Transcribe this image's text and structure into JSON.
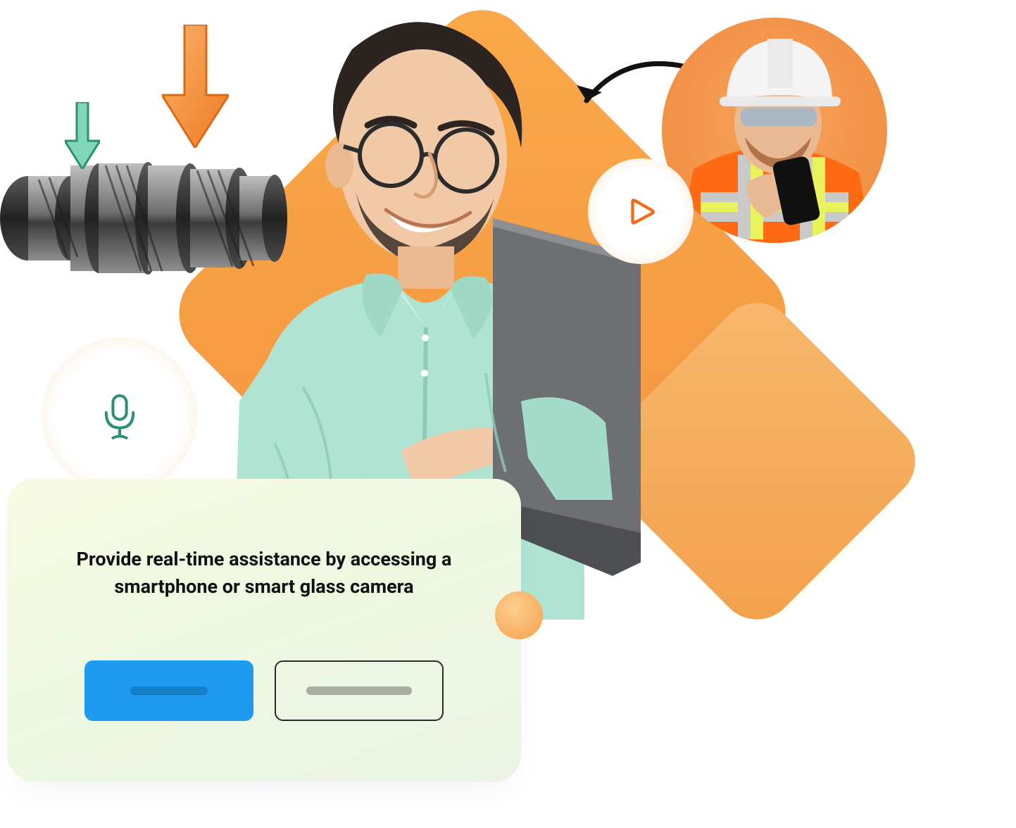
{
  "colors": {
    "accent_orange": "#f3923e",
    "accent_blue": "#1e9bf0",
    "shirt_mint": "#afe3d2",
    "hivis_orange": "#ff6a13",
    "icon_teal": "#2f8f74",
    "icon_orange": "#f26b1d"
  },
  "icons": {
    "play": "play-icon",
    "mic": "microphone-icon",
    "swap": "swap-arrow-icon",
    "down_arrow_big": "down-arrow-icon",
    "down_arrow_small": "down-arrow-icon"
  },
  "people": {
    "expert": "person-with-laptop",
    "technician": "field-technician-with-phone"
  },
  "equipment": {
    "name": "transmission-gear-assembly"
  },
  "card": {
    "headline_line1": "Provide real-time assistance by accessing a",
    "headline_line2": "smartphone or smart glass camera",
    "primary_button_label": "",
    "secondary_button_label": ""
  }
}
